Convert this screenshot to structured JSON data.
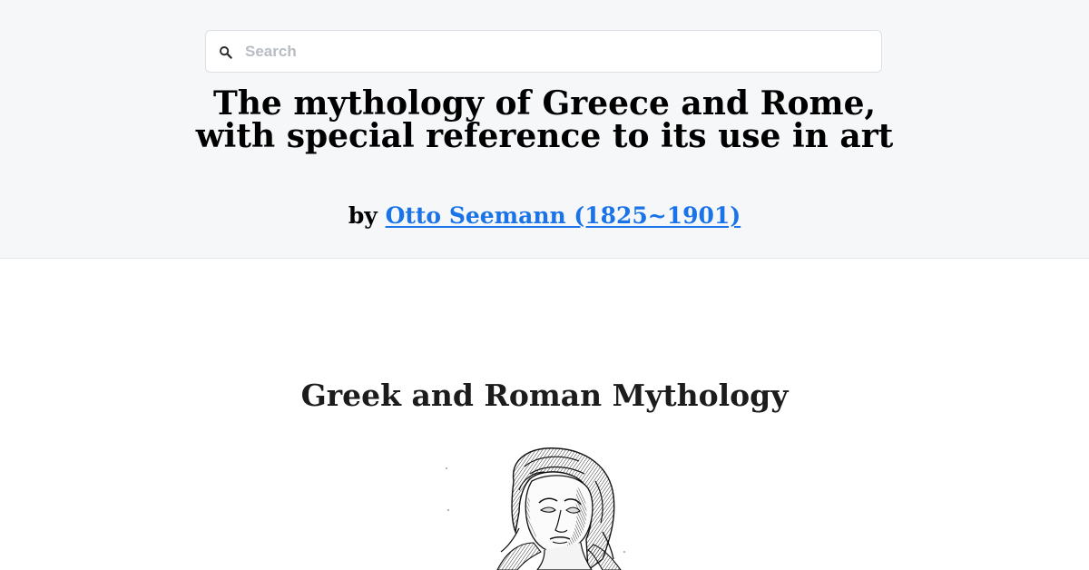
{
  "search": {
    "placeholder": "Search",
    "value": "",
    "icon": "search-icon"
  },
  "book": {
    "title": "The mythology of Greece and Rome, with special reference to its use in art",
    "by_label": "by",
    "author": "Otto Seemann (1825~1901)"
  },
  "content": {
    "heading": "Greek and Roman Mythology",
    "illustration": "engraved-bust-of-classical-goddess"
  },
  "colors": {
    "header_background": "#f6f7f9",
    "link": "#1a73e8",
    "page_background": "#ffffff"
  }
}
